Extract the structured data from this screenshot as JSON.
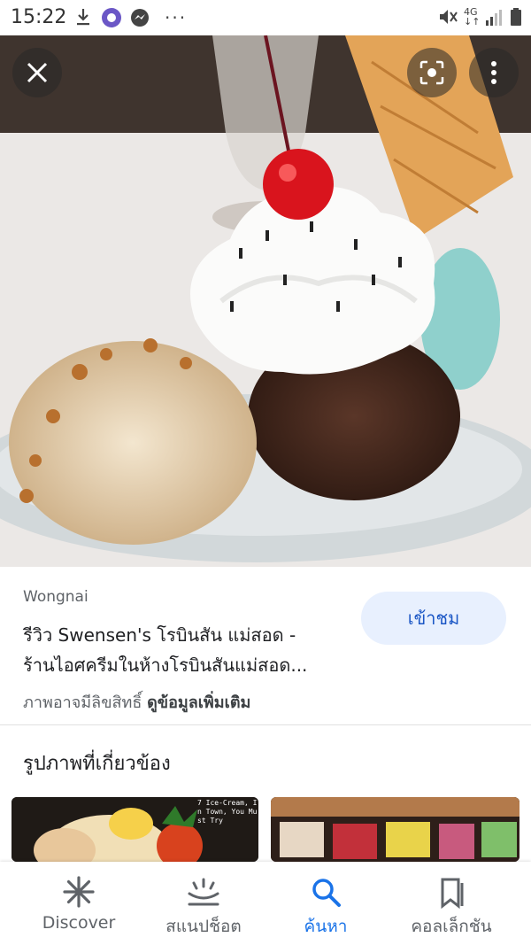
{
  "status_bar": {
    "time": "15:22",
    "signal_text": "4G"
  },
  "hero": {
    "close_icon": "close-icon",
    "lens_icon": "lens-icon",
    "more_icon": "more-vert-icon"
  },
  "result": {
    "source": "Wongnai",
    "title_line1": "รีวิว Swensen's โรบินสัน แม่สอด -",
    "title_line2": "ร้านไอศครีมในห้างโรบินสันแม่สอด...",
    "visit_label": "เข้าชม",
    "rights_text": "ภาพอาจมีลิขสิทธิ์",
    "more_info": "ดูข้อมูลเพิ่มเติม"
  },
  "related": {
    "title": "รูปภาพที่เกี่ยวข้อง",
    "thumb1_text": "7 Ice-Cream, In Town, You Must Try"
  },
  "bottom_nav": {
    "items": [
      {
        "label": "Discover",
        "icon": "asterisk-icon"
      },
      {
        "label": "สแนปช็อต",
        "icon": "snapshot-icon"
      },
      {
        "label": "ค้นหา",
        "icon": "search-icon",
        "active": true
      },
      {
        "label": "คอลเล็กชัน",
        "icon": "collections-icon"
      }
    ]
  },
  "colors": {
    "accent": "#1a73e8",
    "visit_bg": "#e8f0fe"
  }
}
